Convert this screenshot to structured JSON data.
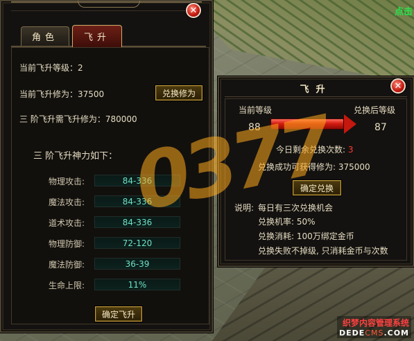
{
  "background": {
    "hint_text": "点击",
    "left_glyph": "单"
  },
  "watermark": {
    "logo_text": "0377",
    "site_line1": "织梦内容管理系统",
    "site_line2_pre": "DEDE",
    "site_line2_accent": "CMS",
    "site_line2_post": ".COM"
  },
  "char_panel": {
    "tabs": [
      {
        "label": "角色",
        "active": false
      },
      {
        "label": "飞升",
        "active": true
      }
    ],
    "current_level_label": "当前飞升等级：",
    "current_level_value": "2",
    "current_cultivation_label": "当前飞升修为：",
    "current_cultivation_value": "37500",
    "exchange_button": "兑换修为",
    "required_label": "三 阶飞升需飞升修为：",
    "required_value": "780000",
    "divine_power_title": "三 阶飞升神力如下：",
    "stats": [
      {
        "label": "物理攻击:",
        "value": "84-336"
      },
      {
        "label": "魔法攻击:",
        "value": "84-336"
      },
      {
        "label": "道术攻击:",
        "value": "84-336"
      },
      {
        "label": "物理防御:",
        "value": "72-120"
      },
      {
        "label": "魔法防御:",
        "value": "36-39"
      },
      {
        "label": "生命上限:",
        "value": "11%"
      }
    ],
    "confirm_button": "确定飞升"
  },
  "exchange_panel": {
    "title": "飞升",
    "current_level_label": "当前等级",
    "after_level_label": "兑换后等级",
    "current_level_value": "88",
    "after_level_value": "87",
    "remaining_label": "今日剩余兑换次数:",
    "remaining_value": "3",
    "gain_label": "兑换成功可获得修为:",
    "gain_value": "375000",
    "confirm_button": "确定兑换",
    "notes_label": "说明:",
    "notes": [
      "每日有三次兑换机会",
      "兑换机率: 50%",
      "兑换消耗: 100万绑定金币",
      "兑换失败不掉级, 只消耗金币与次数"
    ]
  },
  "colors": {
    "panel_bg": "#141210",
    "text_cream": "#e4dcc1",
    "stat_value": "#6fe3c8",
    "remaining_red": "#ff3b2f",
    "arrow_red": "#d21c11",
    "hint_green": "#27e34b",
    "button_border_gold": "#c49d3c"
  }
}
